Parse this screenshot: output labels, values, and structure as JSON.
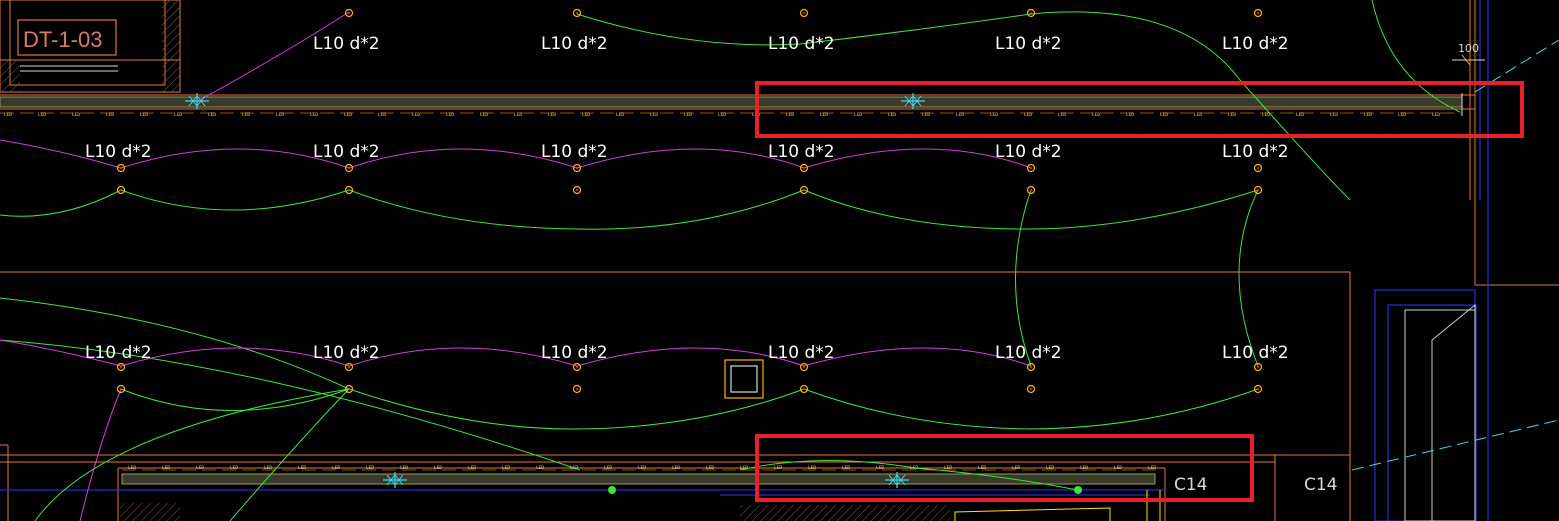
{
  "drawing": {
    "room_tag": "DT-1-03",
    "dimension_text": "100",
    "fixture_label": "L10 d*2",
    "led_text": "LED",
    "strip_tags": [
      "C14",
      "C14"
    ]
  },
  "colors": {
    "background": "#000000",
    "wall": "#e07a3c",
    "circuit_green": "#3ce63c",
    "circuit_magenta": "#d23cdc",
    "fixture": "#ffb400",
    "label": "#ffffff",
    "cyan": "#3cdcf0",
    "highlight": "#e8202a",
    "blue": "#3232ff"
  }
}
